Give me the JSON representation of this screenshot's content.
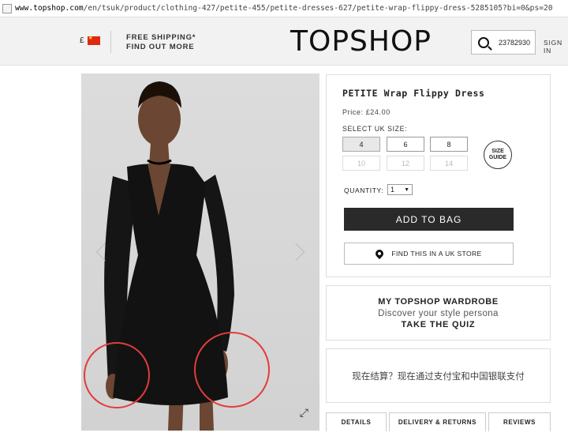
{
  "browser": {
    "url_host": "www.topshop.com",
    "url_path": "/en/tsuk/product/clothing-427/petite-455/petite-dresses-627/petite-wrap-flippy-dress-5285105?bi=0&ps=20"
  },
  "header": {
    "currency_symbol": "£",
    "shipping_line1": "FREE SHIPPING*",
    "shipping_line2": "FIND OUT MORE",
    "logo": "TOPSHOP",
    "search_value": "23782930",
    "signin": "SIGN IN"
  },
  "product": {
    "title": "PETITE Wrap Flippy Dress",
    "price": "Price: £24.00",
    "size_label": "SELECT UK SIZE:",
    "sizes_available": [
      "4",
      "6",
      "8"
    ],
    "sizes_unavailable": [
      "10",
      "12",
      "14"
    ],
    "selected_size": "4",
    "size_guide_line1": "SIZE",
    "size_guide_line2": "GUIDE",
    "quantity_label": "QUANTITY:",
    "quantity_value": "1",
    "add_to_bag": "ADD TO BAG",
    "find_store": "FIND THIS IN A UK STORE"
  },
  "wardrobe": {
    "heading": "MY TOPSHOP WARDROBE",
    "subtitle": "Discover your style persona",
    "cta": "TAKE THE QUIZ"
  },
  "payment_notice": "现在结算？现在通过支付宝和中国银联支付",
  "tabs": [
    "DETAILS",
    "DELIVERY & RETURNS",
    "REVIEWS"
  ],
  "colors": {
    "header_bg": "#f2f2f2",
    "button_dark": "#2a2a2a",
    "annotation_red": "#e43b3b",
    "dress": "#121212"
  },
  "icons": [
    "page-icon",
    "china-flag-icon",
    "search-icon",
    "chevron-left-icon",
    "chevron-right-icon",
    "expand-icon",
    "location-pin-icon",
    "dropdown-arrow-icon"
  ]
}
